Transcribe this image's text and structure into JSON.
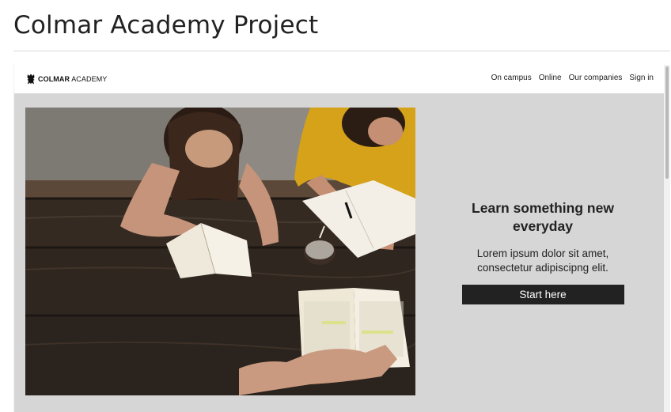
{
  "page": {
    "title": "Colmar Academy Project"
  },
  "site": {
    "logo": {
      "brand": "COLMAR",
      "suffix": "ACADEMY",
      "icon": "lion-crest-icon"
    },
    "nav": {
      "items": [
        {
          "label": "On campus"
        },
        {
          "label": "Online"
        },
        {
          "label": "Our companies"
        },
        {
          "label": "Sign in"
        }
      ]
    },
    "hero": {
      "heading": "Learn something new everyday",
      "text": "Lorem ipsum dolor sit amet, consectetur adipiscipng elit.",
      "cta_label": "Start here",
      "image": "students-studying-at-table-photo"
    }
  },
  "colors": {
    "hero_background": "#d6d6d6",
    "cta_background": "#222222",
    "cta_text": "#ffffff"
  }
}
